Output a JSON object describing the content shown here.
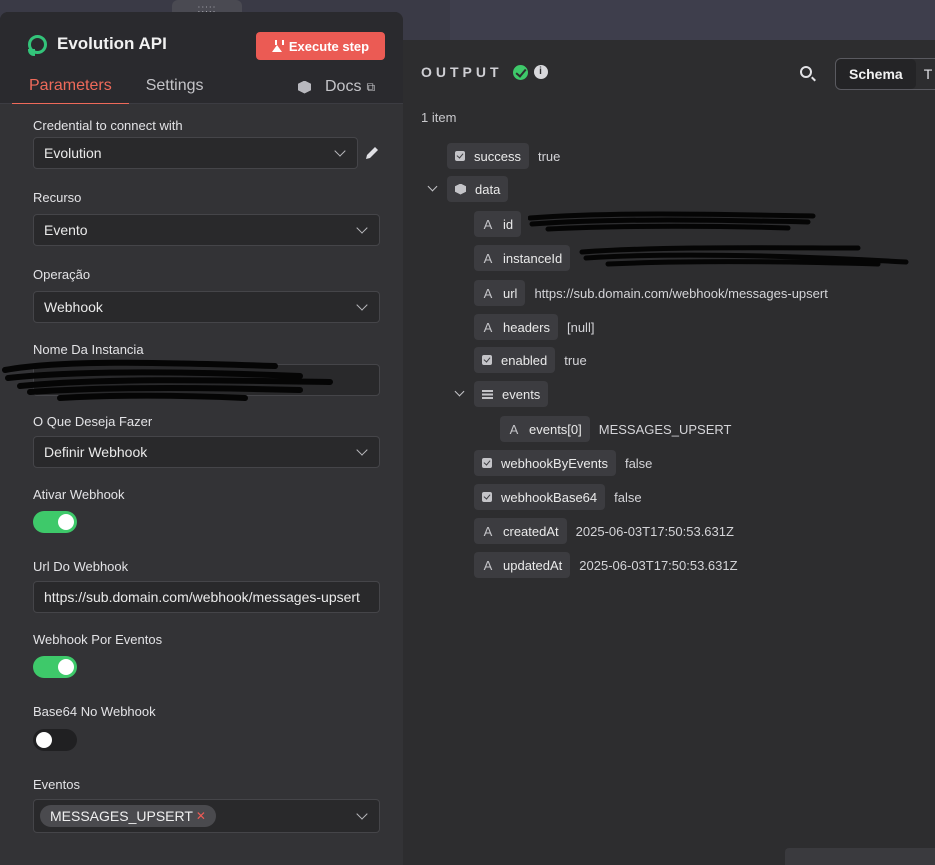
{
  "node": {
    "title": "Evolution API",
    "execute_label": "Execute step",
    "tabs": [
      {
        "label": "Parameters",
        "active": true
      },
      {
        "label": "Settings",
        "active": false
      }
    ],
    "docs_label": "Docs"
  },
  "params": {
    "credential": {
      "label": "Credential to connect with",
      "value": "Evolution"
    },
    "resource": {
      "label": "Recurso",
      "value": "Evento"
    },
    "operation": {
      "label": "Operação",
      "value": "Webhook"
    },
    "instance_name": {
      "label": "Nome Da Instancia",
      "value": ""
    },
    "action": {
      "label": "O Que Deseja Fazer",
      "value": "Definir Webhook"
    },
    "enable_webhook": {
      "label": "Ativar Webhook",
      "on": true
    },
    "webhook_url": {
      "label": "Url Do Webhook",
      "value": "https://sub.domain.com/webhook/messages-upsert"
    },
    "webhook_by_events": {
      "label": "Webhook Por Eventos",
      "on": true
    },
    "base64": {
      "label": "Base64 No Webhook",
      "on": false
    },
    "events": {
      "label": "Eventos",
      "tags": [
        "MESSAGES_UPSERT"
      ]
    }
  },
  "output": {
    "title": "OUTPUT",
    "view_modes": [
      "Schema",
      "T"
    ],
    "item_count": "1 item",
    "rows": {
      "success": {
        "key": "success",
        "value": "true"
      },
      "data": {
        "key": "data"
      },
      "id": {
        "key": "id",
        "value": ""
      },
      "instanceId": {
        "key": "instanceId",
        "value": ""
      },
      "url": {
        "key": "url",
        "value": "https://sub.domain.com/webhook/messages-upsert"
      },
      "headers": {
        "key": "headers",
        "value": "[null]"
      },
      "enabled": {
        "key": "enabled",
        "value": "true"
      },
      "events": {
        "key": "events"
      },
      "events0": {
        "key": "events[0]",
        "value": "MESSAGES_UPSERT"
      },
      "webhookByEvents": {
        "key": "webhookByEvents",
        "value": "false"
      },
      "webhookBase64": {
        "key": "webhookBase64",
        "value": "false"
      },
      "createdAt": {
        "key": "createdAt",
        "value": "2025-06-03T17:50:53.631Z"
      },
      "updatedAt": {
        "key": "updatedAt",
        "value": "2025-06-03T17:50:53.631Z"
      }
    }
  },
  "colors": {
    "accent": "#ef6a5a",
    "execute": "#eb5b54",
    "success": "#3ec96a",
    "panel_bg": "#333336",
    "output_bg": "#2d2d2f"
  }
}
